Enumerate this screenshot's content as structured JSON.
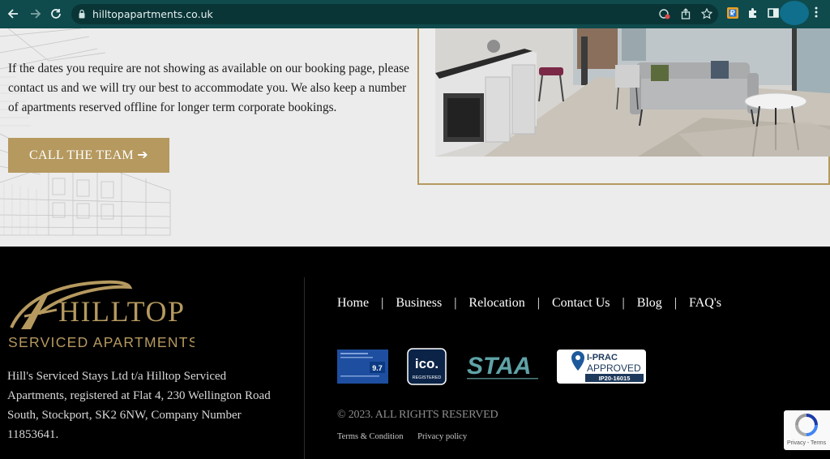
{
  "browser": {
    "url": "hilltopapartments.co.uk"
  },
  "content": {
    "paragraph": "If the dates you require are not showing as available on our booking page, please contact us and we will try our best to accommodate you. We also keep a number of apartments reserved offline for longer term corporate bookings.",
    "cta_label": "CALL THE TEAM",
    "cta_arrow": "➔"
  },
  "footer": {
    "logo": {
      "line1": "HILLTOP",
      "line2": "SERVICED APARTMENTS"
    },
    "company_text": "Hill's Serviced Stays Ltd t/a Hilltop Serviced Apartments, registered at Flat 4, 230 Wellington Road South, Stockport, SK2 6NW, Company Number 11853641.",
    "nav": [
      {
        "label": "Home"
      },
      {
        "label": "Business"
      },
      {
        "label": "Relocation"
      },
      {
        "label": "Contact Us"
      },
      {
        "label": "Blog"
      },
      {
        "label": "FAQ's"
      }
    ],
    "nav_separator": "|",
    "badges": {
      "booking_score": "9.7",
      "ico_main": "ico.",
      "ico_sub": "REGISTERED",
      "staa": "STAA",
      "iprac_line1": "I-PRAC",
      "iprac_line2": "APPROVED",
      "iprac_code": "IP20-16015"
    },
    "copyright": "© 2023. ALL RIGHTS RESERVED",
    "legal": [
      {
        "label": "Terms & Condition"
      },
      {
        "label": "Privacy policy"
      }
    ],
    "recaptcha_terms": "Privacy - Terms"
  },
  "colors": {
    "chrome": "#0f4a4c",
    "gold": "#b5995f",
    "footer_bg": "#000000",
    "page_bg": "#ececec"
  },
  "icons": [
    "back-arrow-icon",
    "forward-arrow-icon",
    "reload-icon",
    "lock-icon",
    "incognito-block-icon",
    "share-icon",
    "star-icon",
    "extension-r-icon",
    "puzzle-icon",
    "sidepanel-icon",
    "kebab-menu-icon",
    "recaptcha-icon"
  ]
}
